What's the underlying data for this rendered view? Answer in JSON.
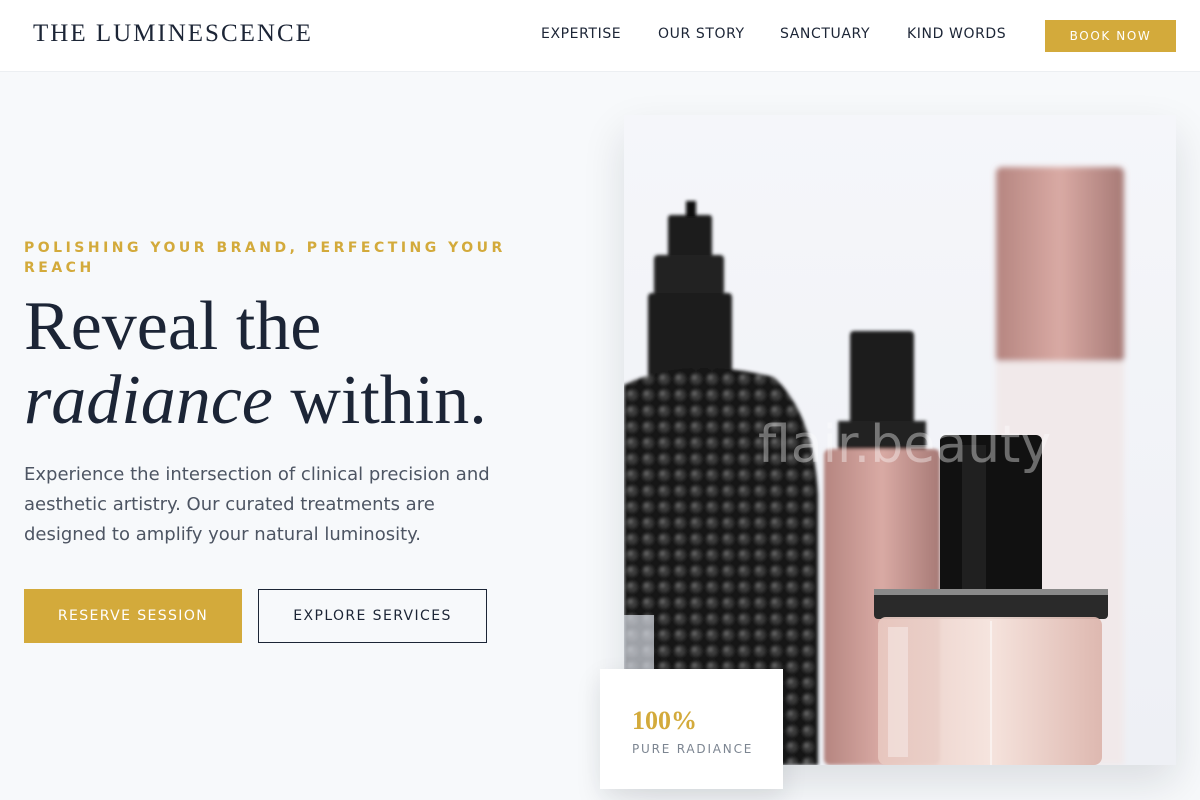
{
  "header": {
    "brand": "THE LUMINESCENCE",
    "nav": [
      "EXPERTISE",
      "OUR STORY",
      "SANCTUARY",
      "KIND WORDS"
    ],
    "cta_label": "BOOK NOW"
  },
  "hero": {
    "eyebrow": "POLISHING YOUR BRAND, PERFECTING YOUR REACH",
    "headline_line1": "Reveal the",
    "headline_italic": "radiance",
    "headline_rest": " within.",
    "lead": "Experience the intersection of clinical precision and aesthetic artistry. Our curated treatments are designed to amplify your natural luminosity.",
    "primary_label": "RESERVE SESSION",
    "secondary_label": "EXPLORE SERVICES"
  },
  "image": {
    "subject": "perfume bottles",
    "watermark": "flair.beauty"
  },
  "stat": {
    "value": "100%",
    "label": "PURE RADIANCE"
  },
  "colors": {
    "accent": "#d3aa3b",
    "navy": "#1c2536",
    "background": "#f7f9fb"
  }
}
